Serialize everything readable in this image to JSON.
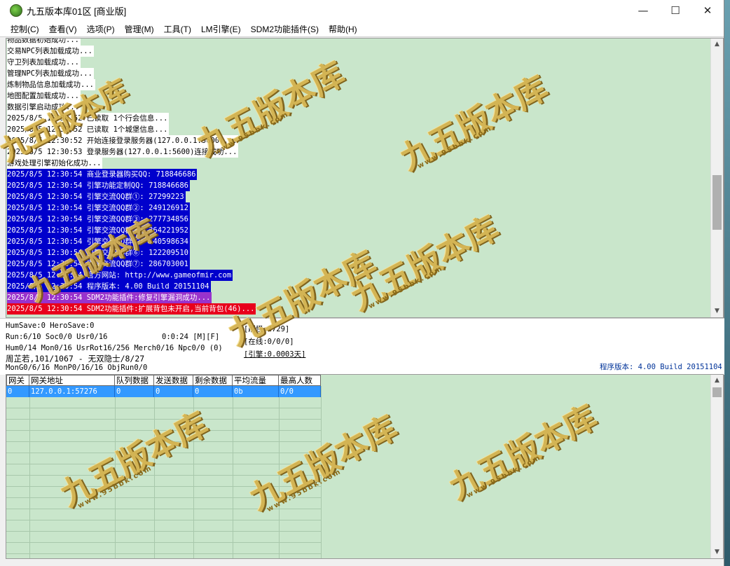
{
  "window": {
    "title": "九五版本库01区 [商业版]"
  },
  "menu": [
    "控制(C)",
    "查看(V)",
    "选项(P)",
    "管理(M)",
    "工具(T)",
    "LM引擎(E)",
    "SDM2功能插件(S)",
    "帮助(H)"
  ],
  "log": [
    {
      "text": "物品数据初始成功...",
      "style": "white"
    },
    {
      "text": "交易NPC列表加载成功...",
      "style": "white"
    },
    {
      "text": "守卫列表加载成功...",
      "style": "white"
    },
    {
      "text": "管理NPC列表加载成功...",
      "style": "white"
    },
    {
      "text": "炼制物品信息加载成功...",
      "style": "white"
    },
    {
      "text": "地图配置加载成功...",
      "style": "white"
    },
    {
      "text": "数据引擎启动成功...",
      "style": "white"
    },
    {
      "text": "2025/8/5 12:30:52 已读取 1个行会信息...",
      "style": "white"
    },
    {
      "text": "2025/8/5 12:30:52 已读取 1个城堡信息...",
      "style": "white"
    },
    {
      "text": "2025/8/5 12:30:52 开始连接登录服务器(127.0.0.1:5600)...",
      "style": "white"
    },
    {
      "text": "2025/8/5 12:30:53 登录服务器(127.0.0.1:5600)连接成功...",
      "style": "white"
    },
    {
      "text": "游戏处理引擎初始化成功...",
      "style": "white"
    },
    {
      "text": "2025/8/5 12:30:54 商业登录器购买QQ: 718846686",
      "style": "blue"
    },
    {
      "text": "2025/8/5 12:30:54 引擎功能定制QQ: 718846686",
      "style": "blue"
    },
    {
      "text": "2025/8/5 12:30:54 引擎交流QQ群①: 27299223",
      "style": "blue"
    },
    {
      "text": "2025/8/5 12:30:54 引擎交流QQ群②: 249126912",
      "style": "blue"
    },
    {
      "text": "2025/8/5 12:30:54 引擎交流QQ群③: 277734856",
      "style": "blue"
    },
    {
      "text": "2025/8/5 12:30:54 引擎交流QQ群④: 264221952",
      "style": "blue"
    },
    {
      "text": "2025/8/5 12:30:54 引擎交流QQ群⑤: 140598634",
      "style": "blue"
    },
    {
      "text": "2025/8/5 12:30:54 引擎交流QQ群⑥: 122209510",
      "style": "blue"
    },
    {
      "text": "2025/8/5 12:30:54 引擎交流QQ群⑦: 286703001",
      "style": "blue"
    },
    {
      "text": "2025/8/5 12:30:54 官方网站: http://www.gameofmir.com",
      "style": "blue"
    },
    {
      "text": "2025/8/5 12:30:54 程序版本: 4.00 Build 20151104",
      "style": "blue"
    },
    {
      "text": "2025/8/5 12:30:54 SDM2功能插件:修复引擎漏洞成功...",
      "style": "purple"
    },
    {
      "text": "2025/8/5 12:30:54 SDM2功能插件:扩展背包未开启,当前背包(46)...",
      "style": "red"
    }
  ],
  "status": {
    "line1": "HumSave:0 HeroSave:0",
    "line2": "Run:6/10 Soc0/0 Usr0/16",
    "timer": "0:0:24 [M][F]",
    "line3": "Hum0/14 Mon0/16 UsrRot16/256 Merch0/16 Npc0/0 (0)",
    "line4": "周芷若,101/1067 - 无双隐士/8/27",
    "line5": "MonG0/6/16 MonP0/16/16 ObjRun0/0",
    "monsters": "[刷怪:2729]",
    "online": "[在线:0/0/0]",
    "engine": "[引擎:0.0003天]",
    "version": "程序版本: 4.00 Build 20151104"
  },
  "grid": {
    "columns": [
      "网关",
      "网关地址",
      "队列数据",
      "发送数据",
      "剩余数据",
      "平均流量",
      "最高人数"
    ],
    "rows": [
      [
        "0",
        "127.0.0.1:57276",
        "0",
        "0",
        "0",
        "0b",
        "0/0"
      ]
    ]
  },
  "watermark": {
    "main": "九五版本库",
    "sub": "www.95bbk.com"
  },
  "colors": {
    "log_bg": "#c9e6cb",
    "blue_line": "#0000cc",
    "red_line": "#e8001c",
    "purple_line": "#9933cc",
    "selected_row": "#3399ff"
  }
}
